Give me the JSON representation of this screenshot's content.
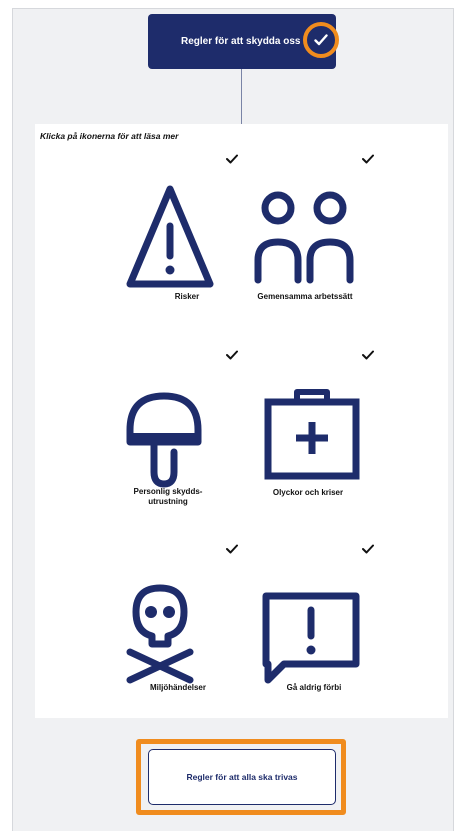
{
  "top_button": {
    "label": "Regler för att skydda oss"
  },
  "instruction": "Klicka på ikonerna för att läsa mer",
  "cards": [
    {
      "label": "Risker",
      "icon": "warning-triangle-icon",
      "completed": true
    },
    {
      "label": "Gemensamma arbetssätt",
      "icon": "people-icon",
      "completed": true
    },
    {
      "label_line1": "Personlig skydds-",
      "label_line2": "utrustning",
      "icon": "hard-hat-icon",
      "completed": true
    },
    {
      "label": "Olyckor och kriser",
      "icon": "first-aid-kit-icon",
      "completed": true
    },
    {
      "label": "Miljöhändelser",
      "icon": "skull-crossbones-icon",
      "completed": true
    },
    {
      "label": "Gå aldrig förbi",
      "icon": "exclamation-speech-bubble-icon",
      "completed": true
    }
  ],
  "bottom_button": {
    "label": "Regler för att alla ska trivas"
  },
  "colors": {
    "navy": "#1e2c6b",
    "orange": "#f08c1e",
    "background": "#f0f1f3"
  }
}
